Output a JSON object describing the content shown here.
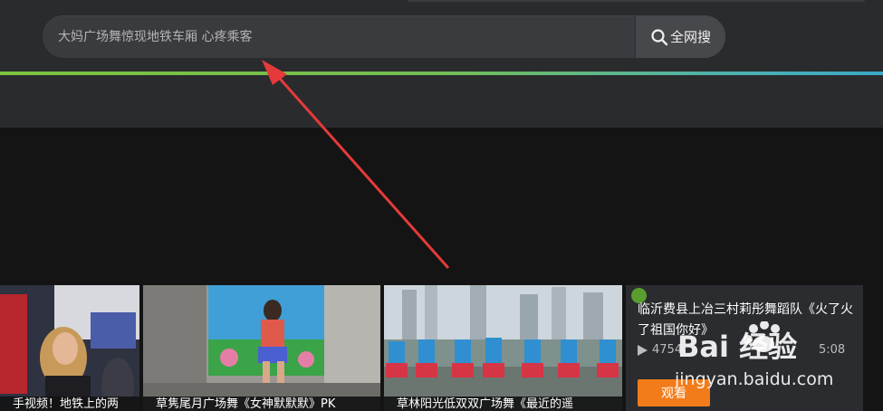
{
  "search": {
    "placeholder": "大妈广场舞惊现地铁车厢 心疼乘客",
    "button_label": "全网搜"
  },
  "videos": [
    {
      "caption": "手视频！地铁上的两"
    },
    {
      "caption": "草隽尾月广场舞《女神默默默》PK"
    },
    {
      "caption": "草林阳光低双双广场舞《最近的遥"
    },
    {
      "title": "临沂费县上冶三村莉彤舞蹈队《火了火了祖国你好》",
      "views": "4754",
      "duration": "5:08",
      "watch_label": "观看"
    }
  ],
  "watermark": {
    "text": "Bai 经验",
    "url": "jingyan.baidu.com"
  },
  "colors": {
    "header_bg": "#2a2b2d",
    "gradient_start": "#7cc33d",
    "gradient_end": "#3aa8c6",
    "annotation_arrow": "#e53a3a",
    "watch_button": "#f27c1a"
  }
}
